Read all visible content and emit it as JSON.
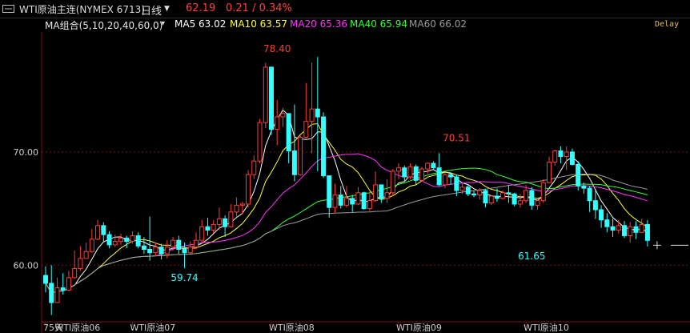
{
  "header": {
    "contract": "WTI原油主连(NYMEX 6713)",
    "period": "日线",
    "period_arrow": "▼",
    "price": "62.19",
    "change": "0.21 / 0.34%",
    "price_color": "#ff4040",
    "delay_label": "Delay"
  },
  "ma_legend": [
    {
      "text": "MA组合(5,10,20,40,60,0)",
      "color": "#e8e8e8"
    },
    {
      "text": "MA5 63.02",
      "color": "#ffffff"
    },
    {
      "text": "MA10 63.57",
      "color": "#ffff33"
    },
    {
      "text": "MA20 65.36",
      "color": "#ff33ff"
    },
    {
      "text": "MA40 65.94",
      "color": "#33ff33"
    },
    {
      "text": "MA60 66.02",
      "color": "#9a9a9a"
    }
  ],
  "colors": {
    "up": "#ff3b3b",
    "down": "#33ffff",
    "grid": "#7a1414",
    "axis": "#7a1414"
  },
  "chart_data": {
    "type": "candlestick",
    "y_ticks": [
      "70.00",
      "60.00"
    ],
    "ylim": [
      55.0,
      80.6
    ],
    "x_labels": [
      {
        "label": "75天",
        "index": 0
      },
      {
        "label": "WTI原油06",
        "index": 2
      },
      {
        "label": "WTI原油07",
        "index": 15
      },
      {
        "label": "WTI原油08",
        "index": 39
      },
      {
        "label": "WTI原油09",
        "index": 61
      },
      {
        "label": "WTI原油10",
        "index": 83
      }
    ],
    "annotations": [
      {
        "text": "78.40",
        "index": 40,
        "value": 78.4,
        "color": "#ff3b3b",
        "position": "above"
      },
      {
        "text": "70.51",
        "index": 71,
        "value": 70.51,
        "color": "#ff3b3b",
        "position": "above"
      },
      {
        "text": "59.74",
        "index": 24,
        "value": 59.74,
        "color": "#33ffff",
        "position": "below"
      },
      {
        "text": "61.65",
        "index": 84,
        "value": 61.65,
        "color": "#33ffff",
        "position": "below"
      }
    ],
    "candles": [
      [
        59.1,
        58.4,
        59.9,
        57.6
      ],
      [
        58.4,
        56.7,
        60.0,
        55.6
      ],
      [
        56.7,
        58.0,
        58.9,
        56.7
      ],
      [
        58.0,
        57.8,
        59.3,
        57.4
      ],
      [
        57.8,
        58.9,
        59.5,
        57.7
      ],
      [
        58.9,
        59.7,
        61.3,
        58.8
      ],
      [
        59.7,
        60.6,
        61.7,
        59.5
      ],
      [
        60.6,
        61.2,
        62.0,
        60.6
      ],
      [
        61.2,
        62.3,
        63.2,
        61.1
      ],
      [
        62.3,
        63.5,
        64.0,
        62.2
      ],
      [
        63.5,
        62.7,
        63.8,
        62.1
      ],
      [
        62.7,
        61.8,
        63.0,
        61.5
      ],
      [
        61.8,
        62.1,
        62.7,
        61.6
      ],
      [
        62.1,
        62.4,
        62.8,
        61.8
      ],
      [
        62.4,
        62.1,
        62.6,
        61.5
      ],
      [
        62.1,
        62.6,
        63.0,
        61.9
      ],
      [
        62.6,
        61.7,
        62.9,
        61.5
      ],
      [
        61.7,
        61.4,
        62.5,
        61.0
      ],
      [
        61.4,
        61.1,
        64.3,
        60.4
      ],
      [
        61.1,
        61.6,
        62.0,
        60.8
      ],
      [
        61.6,
        61.0,
        61.9,
        60.5
      ],
      [
        61.0,
        61.6,
        62.2,
        60.6
      ],
      [
        61.6,
        62.2,
        62.5,
        61.3
      ],
      [
        62.2,
        61.4,
        62.6,
        61.0
      ],
      [
        61.4,
        61.1,
        62.0,
        59.74
      ],
      [
        61.1,
        61.6,
        62.1,
        61.0
      ],
      [
        61.6,
        62.2,
        62.9,
        61.4
      ],
      [
        62.2,
        63.4,
        64.0,
        62.0
      ],
      [
        63.4,
        63.1,
        64.2,
        62.6
      ],
      [
        63.1,
        63.6,
        64.0,
        62.8
      ],
      [
        63.6,
        64.1,
        65.1,
        63.1
      ],
      [
        64.1,
        63.4,
        64.4,
        62.5
      ],
      [
        63.4,
        64.7,
        65.4,
        63.3
      ],
      [
        64.7,
        65.3,
        66.0,
        64.3
      ],
      [
        65.3,
        65.4,
        65.6,
        64.5
      ],
      [
        65.4,
        68.0,
        68.4,
        65.1
      ],
      [
        68.0,
        69.2,
        69.7,
        67.6
      ],
      [
        69.2,
        72.6,
        72.9,
        69.0
      ],
      [
        72.6,
        77.5,
        77.9,
        72.1
      ],
      [
        77.5,
        72.0,
        76.8,
        71.5
      ],
      [
        72.0,
        73.1,
        74.6,
        70.6
      ],
      [
        73.1,
        73.4,
        73.9,
        72.2
      ],
      [
        73.4,
        70.1,
        72.9,
        69.0
      ],
      [
        70.1,
        68.0,
        74.2,
        67.4
      ],
      [
        68.0,
        71.3,
        71.5,
        67.9
      ],
      [
        71.3,
        72.7,
        76.1,
        71.2
      ],
      [
        72.7,
        73.8,
        77.9,
        69.9
      ],
      [
        73.8,
        73.1,
        78.4,
        68.3
      ],
      [
        73.1,
        67.9,
        73.5,
        67.7
      ],
      [
        67.9,
        65.1,
        67.9,
        64.2
      ],
      [
        65.1,
        66.2,
        67.2,
        64.6
      ],
      [
        66.2,
        65.3,
        67.0,
        65.0
      ],
      [
        65.3,
        65.9,
        67.0,
        65.1
      ],
      [
        65.9,
        65.4,
        66.2,
        64.7
      ],
      [
        65.4,
        66.4,
        66.9,
        65.3
      ],
      [
        66.4,
        65.0,
        66.5,
        64.9
      ],
      [
        65.0,
        65.7,
        66.5,
        64.8
      ],
      [
        65.7,
        67.1,
        68.3,
        65.6
      ],
      [
        67.1,
        65.9,
        67.1,
        65.5
      ],
      [
        65.9,
        66.4,
        67.6,
        65.5
      ],
      [
        66.4,
        68.3,
        68.5,
        66.1
      ],
      [
        68.3,
        68.6,
        69.0,
        67.6
      ],
      [
        68.6,
        67.8,
        68.8,
        67.4
      ],
      [
        67.8,
        68.7,
        69.0,
        67.6
      ],
      [
        68.7,
        67.5,
        68.9,
        67.1
      ],
      [
        67.5,
        68.5,
        68.7,
        67.4
      ],
      [
        68.5,
        69.0,
        69.1,
        68.1
      ],
      [
        69.0,
        68.6,
        69.2,
        68.5
      ],
      [
        68.6,
        67.1,
        69.9,
        67.0
      ],
      [
        67.1,
        68.0,
        68.2,
        66.8
      ],
      [
        68.0,
        67.8,
        68.2,
        67.1
      ],
      [
        67.8,
        66.6,
        68.0,
        66.1
      ],
      [
        66.6,
        66.9,
        67.3,
        66.3
      ],
      [
        66.9,
        66.3,
        67.1,
        66.1
      ],
      [
        66.3,
        66.2,
        66.6,
        66.0
      ],
      [
        66.2,
        66.6,
        66.8,
        65.8
      ],
      [
        66.6,
        65.5,
        66.7,
        65.1
      ],
      [
        65.5,
        66.1,
        66.2,
        65.3
      ],
      [
        66.1,
        65.9,
        66.8,
        65.6
      ],
      [
        65.9,
        66.4,
        66.6,
        65.8
      ],
      [
        66.4,
        66.3,
        67.1,
        65.5
      ],
      [
        66.3,
        65.4,
        66.4,
        65.2
      ],
      [
        65.4,
        65.7,
        66.3,
        65.1
      ],
      [
        65.7,
        66.6,
        67.1,
        65.5
      ],
      [
        66.6,
        65.3,
        66.9,
        64.9
      ],
      [
        65.3,
        65.7,
        65.8,
        64.9
      ],
      [
        65.7,
        67.3,
        67.6,
        65.5
      ],
      [
        67.3,
        69.1,
        69.6,
        67.2
      ],
      [
        69.1,
        70.1,
        70.2,
        68.8
      ],
      [
        70.1,
        69.6,
        70.51,
        69.0
      ],
      [
        69.6,
        70.0,
        70.5,
        68.4
      ],
      [
        70.0,
        68.9,
        70.3,
        68.8
      ],
      [
        68.9,
        67.0,
        69.2,
        66.6
      ],
      [
        67.0,
        66.8,
        67.3,
        66.3
      ],
      [
        66.8,
        65.7,
        67.0,
        64.7
      ],
      [
        65.7,
        64.9,
        66.6,
        64.1
      ],
      [
        64.9,
        64.0,
        65.3,
        63.3
      ],
      [
        64.0,
        63.4,
        64.6,
        62.9
      ],
      [
        63.4,
        63.1,
        64.1,
        62.5
      ],
      [
        63.1,
        63.5,
        64.0,
        62.8
      ],
      [
        63.5,
        62.6,
        63.9,
        62.4
      ],
      [
        62.6,
        63.4,
        63.8,
        62.0
      ],
      [
        63.4,
        62.9,
        63.9,
        62.3
      ],
      [
        62.9,
        63.6,
        64.1,
        62.9
      ],
      [
        63.6,
        62.19,
        64.0,
        61.65
      ]
    ],
    "ma_colors": [
      "#ffffff",
      "#ffff33",
      "#ff33ff",
      "#33ff33",
      "#9a9a9a"
    ],
    "ma_names": [
      "MA5",
      "MA10",
      "MA20",
      "MA40",
      "MA60"
    ]
  }
}
